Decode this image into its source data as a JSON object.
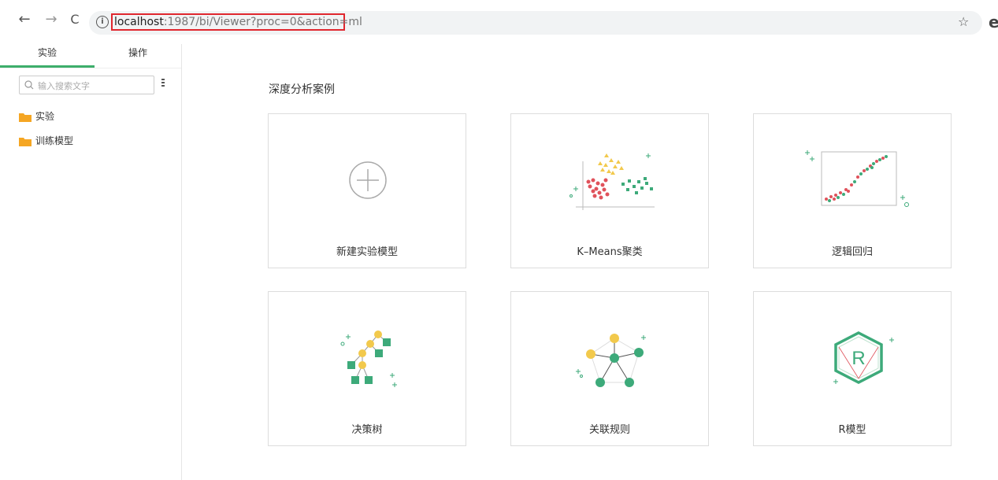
{
  "browser": {
    "back_label": "←",
    "forward_label": "→",
    "reload_label": "C",
    "info_label": "i",
    "url_host": "localhost",
    "url_rest": ":1987/bi/Viewer?proc=0&action=ml",
    "star_label": "☆",
    "account_label": "e"
  },
  "sidebar": {
    "tabs": [
      {
        "label": "实验",
        "active": true
      },
      {
        "label": "操作",
        "active": false
      }
    ],
    "search_placeholder": "输入搜索文字",
    "tree": [
      {
        "label": "实验"
      },
      {
        "label": "训练模型"
      }
    ]
  },
  "main": {
    "title": "深度分析案例",
    "cards": [
      {
        "label": "新建实验模型",
        "icon": "plus-circle-icon"
      },
      {
        "label": "K–Means聚类",
        "icon": "kmeans-scatter-icon"
      },
      {
        "label": "逻辑回归",
        "icon": "logistic-regression-icon"
      },
      {
        "label": "决策树",
        "icon": "decision-tree-icon"
      },
      {
        "label": "关联规则",
        "icon": "association-rule-icon"
      },
      {
        "label": "R模型",
        "icon": "r-model-icon"
      }
    ]
  },
  "colors": {
    "accent_green": "#3dae6b",
    "folder_orange": "#f5a623",
    "url_highlight": "#e0272e",
    "yellow": "#f2c94c",
    "red": "#e0525b",
    "teal": "#3daa7a"
  }
}
